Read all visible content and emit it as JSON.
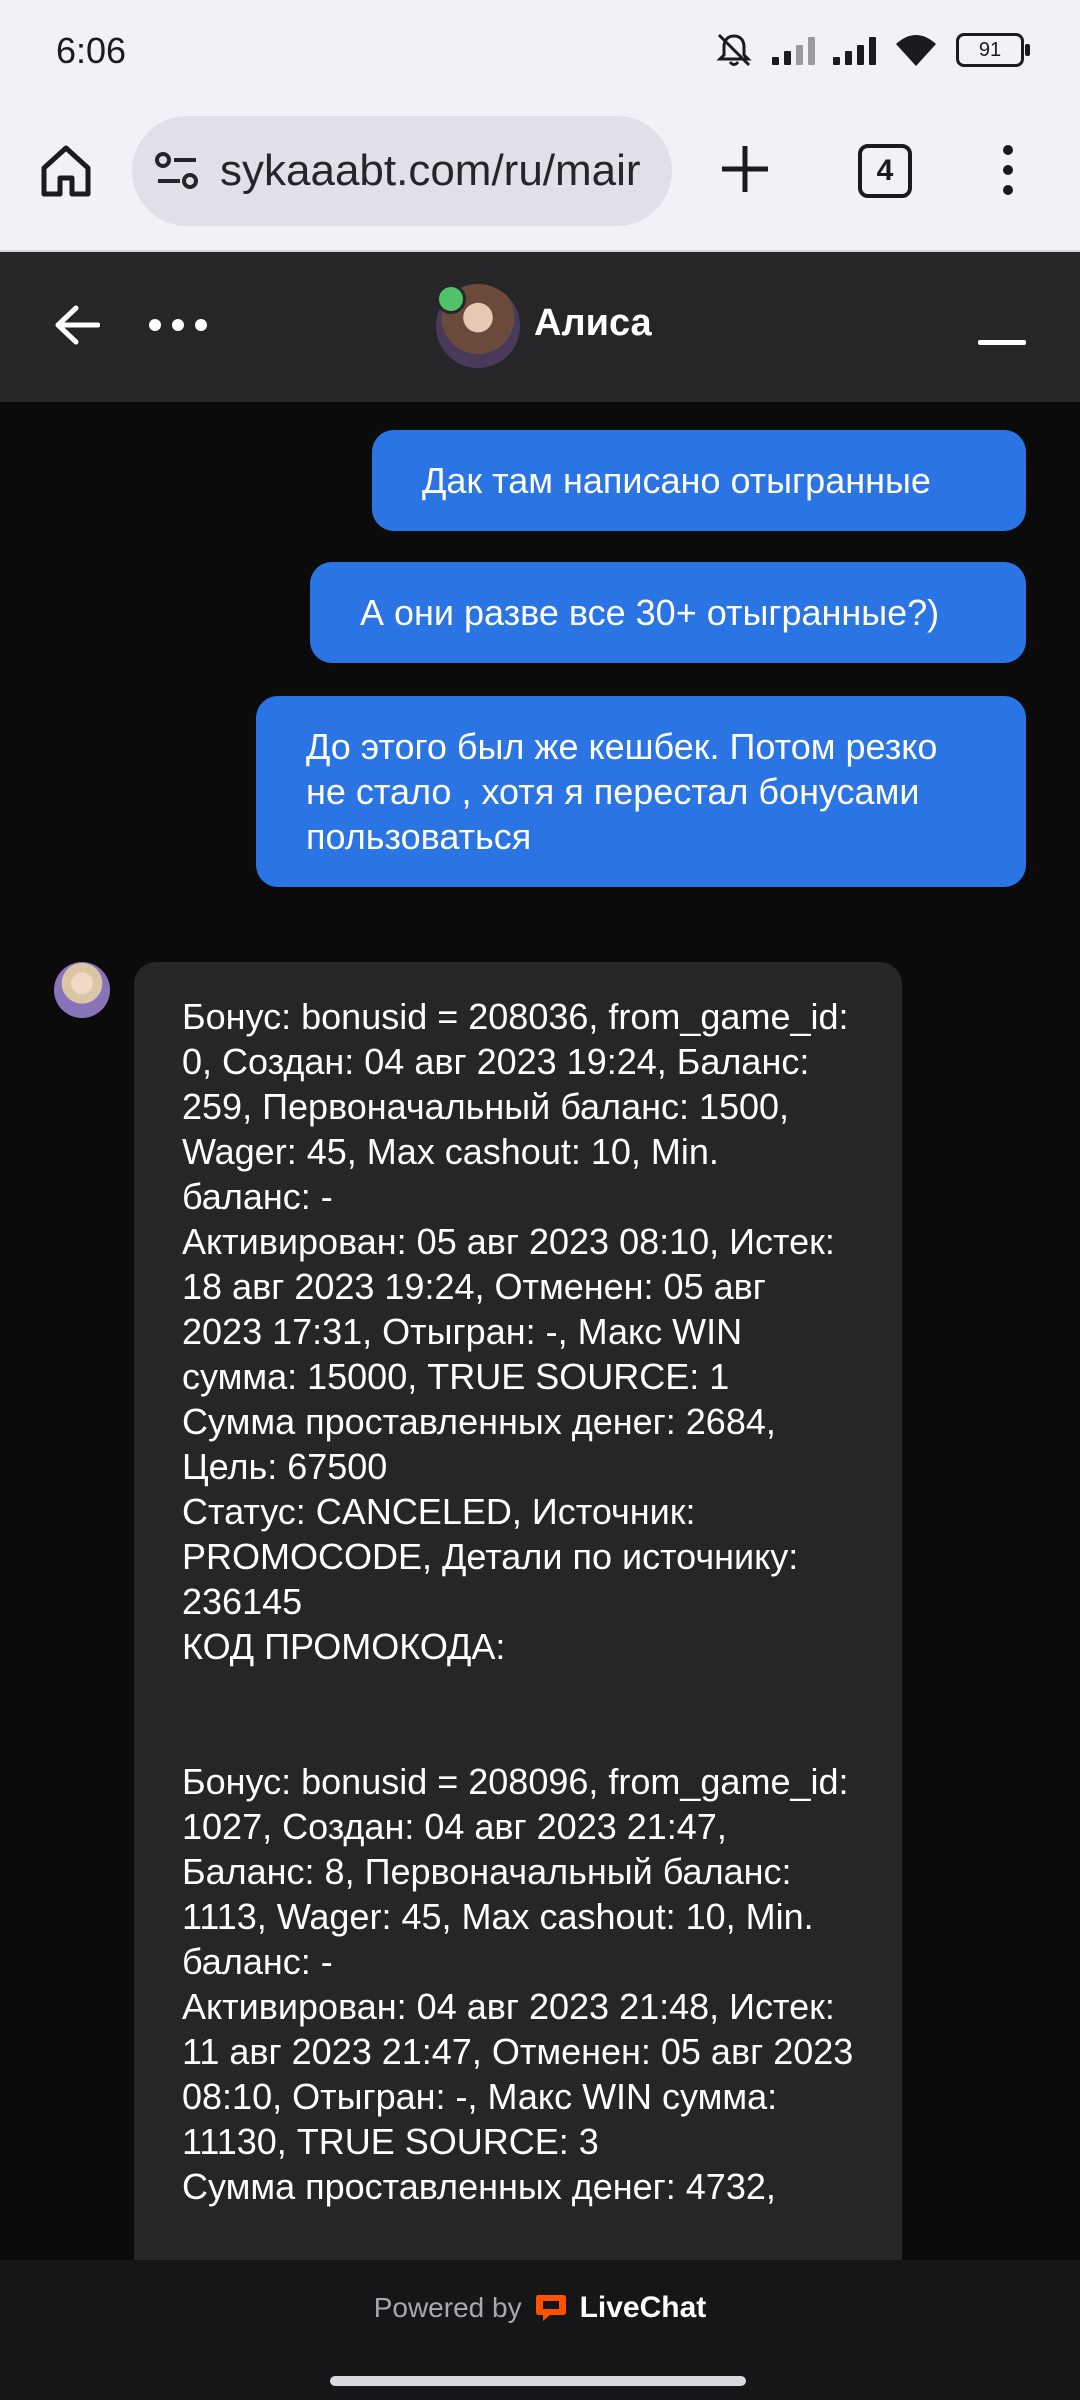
{
  "status_bar": {
    "time": "6:06",
    "battery": "91",
    "icons": [
      "mute-icon",
      "signal-1-icon",
      "signal-2-icon",
      "wifi-icon",
      "battery-icon"
    ]
  },
  "browser": {
    "url": "sykaaabt.com/ru/mair",
    "tab_count": "4",
    "icons": [
      "home-icon",
      "site-settings-icon",
      "new-tab-icon",
      "tabs-icon",
      "menu-icon"
    ]
  },
  "chat_header": {
    "agent_name": "Алиса",
    "icons": [
      "back-arrow-icon",
      "more-icon",
      "minimize-icon"
    ],
    "online_color": "#51c26a"
  },
  "messages": {
    "outgoing": [
      "Дак там написано отыгранные",
      "А они разве все 30+ отыгранные?)",
      "До этого был же кешбек. Потом резко не стало , хотя я перестал бонусами пользоваться"
    ],
    "incoming": "Бонус: bonusid = 208036, from_game_id: 0, Создан: 04 авг 2023 19:24, Баланс: 259, Первоначальный баланс: 1500, Wager: 45, Max cashout: 10, Min. баланс: -\nАктивирован: 05 авг 2023 08:10, Истек: 18 авг 2023 19:24, Отменен: 05 авг 2023 17:31, Отыгран: -, Макс WIN сумма: 15000, TRUE SOURCE: 1\nСумма проставленных денег: 2684, Цель: 67500\nСтатус: CANCELED, Источник: PROMOCODE, Детали по источнику: 236145\nКОД ПРОМОКОДА:\n\n\nБонус: bonusid = 208096, from_game_id: 1027, Создан: 04 авг 2023 21:47, Баланс: 8, Первоначальный баланс: 1113, Wager: 45, Max cashout: 10, Min. баланс: -\nАктивирован: 04 авг 2023 21:48, Истек: 11 авг 2023 21:47, Отменен: 05 авг 2023 08:10, Отыгран: -, Макс WIN сумма: 11130, TRUE SOURCE: 3\nСумма проставленных денег: 4732,"
  },
  "footer": {
    "powered_by": "Powered by",
    "brand": "LiveChat",
    "brand_color": "#ff5100"
  },
  "colors": {
    "outgoing_bubble": "#2b74e3",
    "incoming_bubble": "#262628",
    "chat_background": "#0b0b0c"
  }
}
